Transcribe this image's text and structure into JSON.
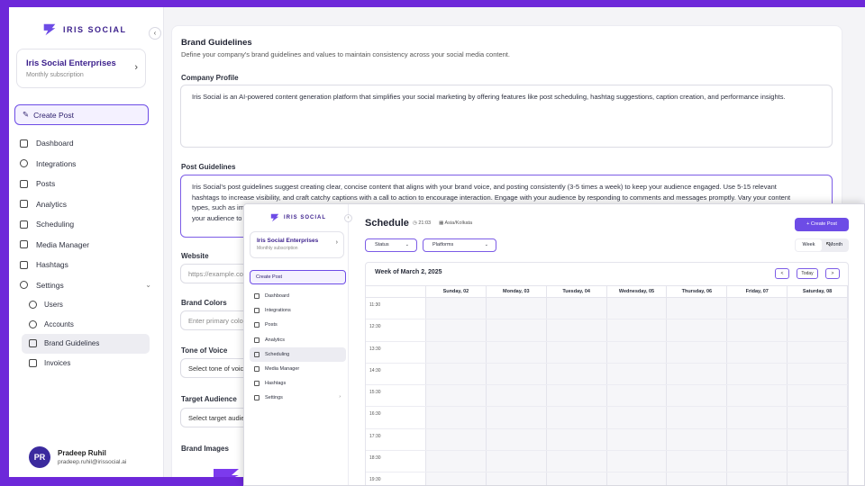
{
  "sidebar": {
    "logo_text": "IRIS SOCIAL",
    "org_name": "Iris Social Enterprises",
    "org_sub": "Monthly subscription",
    "create_post": "Create Post",
    "items": [
      {
        "label": "Dashboard",
        "icon": "dashboard-icon"
      },
      {
        "label": "Integrations",
        "icon": "plug-icon"
      },
      {
        "label": "Posts",
        "icon": "posts-icon"
      },
      {
        "label": "Analytics",
        "icon": "chart-icon"
      },
      {
        "label": "Scheduling",
        "icon": "calendar-icon"
      },
      {
        "label": "Media Manager",
        "icon": "image-icon"
      },
      {
        "label": "Hashtags",
        "icon": "hashtag-icon"
      },
      {
        "label": "Settings",
        "icon": "gear-icon"
      }
    ],
    "settings_sub": [
      "Users",
      "Accounts",
      "Brand Guidelines",
      "Invoices"
    ],
    "user_initials": "PR",
    "user_name": "Pradeep Ruhil",
    "user_email": "pradeep.ruhil@irissocial.ai"
  },
  "brand": {
    "title": "Brand Guidelines",
    "description": "Define your company's brand guidelines and values to maintain consistency across your social media content.",
    "company_profile_label": "Company Profile",
    "company_profile": "Iris Social is an AI-powered content generation platform that simplifies your social marketing by offering features like post scheduling, hashtag suggestions, caption creation, and performance insights.",
    "post_guidelines_label": "Post Guidelines",
    "post_guidelines_line1": "Iris Social's post guidelines suggest creating clear, concise content that aligns with your brand voice, and posting consistently (3-5 times a week) to keep your audience engaged. Use 5-15 relevant",
    "post_guidelines_line2": "hashtags to increase visibility, and craft catchy captions with a call to action to encourage interaction. Engage with your audience by responding to comments and messages promptly. Vary your content",
    "post_guidelines_line3": "types, such as ima",
    "post_guidelines_line4": "your audience to m",
    "website_label": "Website",
    "website_placeholder": "https://example.co",
    "brand_colors_label": "Brand Colors",
    "brand_colors_placeholder": "Enter primary colo",
    "tone_label": "Tone of Voice",
    "tone_value": "Select tone of voic",
    "audience_label": "Target Audience",
    "audience_value": "Select target audie",
    "images_label": "Brand Images",
    "close_glyph": "×"
  },
  "schedule": {
    "logo_text": "IRIS SOCIAL",
    "org_name": "Iris Social Enterprises",
    "org_sub": "Monthly subscription",
    "create_post": "Create Post",
    "nav": [
      "Dashboard",
      "Integrations",
      "Posts",
      "Analytics",
      "Scheduling",
      "Media Manager",
      "Hashtags",
      "Settings"
    ],
    "title": "Schedule",
    "time": "21:03",
    "timezone": "Asia/Kolkata",
    "create_button": "+ Create Post",
    "status_filter": "Status",
    "platforms_filter": "Platforms",
    "view_week": "Week",
    "view_month": "Month",
    "week_label": "Week of March 2, 2025",
    "prev": "<",
    "today": "Today",
    "next": ">",
    "days": [
      "Sunday, 02",
      "Monday, 03",
      "Tuesday, 04",
      "Wednesday, 05",
      "Thursday, 06",
      "Friday, 07",
      "Saturday, 08"
    ],
    "times": [
      "11:30",
      "12:30",
      "13:30",
      "14:30",
      "15:30",
      "16:30",
      "17:30",
      "18:30",
      "19:30"
    ]
  },
  "colors": {
    "accent": "#6d4ce6",
    "frame": "#6d28d9",
    "brand_dark": "#3b1f8c"
  }
}
